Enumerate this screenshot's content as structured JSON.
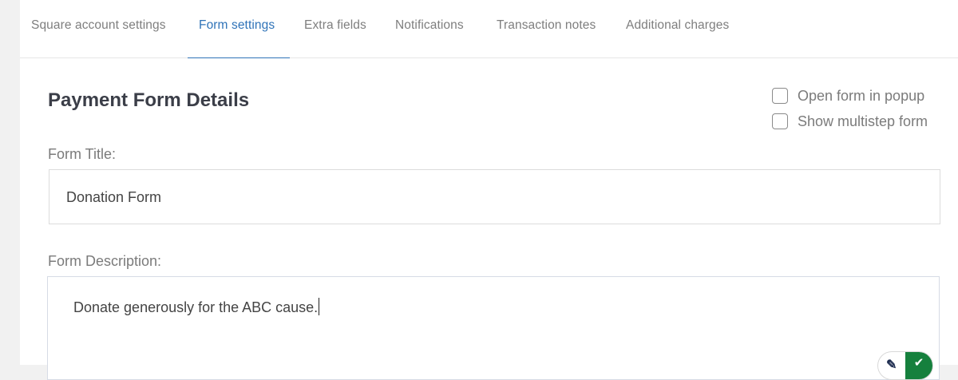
{
  "tabs": [
    {
      "label": "Square account settings",
      "active": false
    },
    {
      "label": "Form settings",
      "active": true
    },
    {
      "label": "Extra fields",
      "active": false
    },
    {
      "label": "Notifications",
      "active": false
    },
    {
      "label": "Transaction notes",
      "active": false
    },
    {
      "label": "Additional charges",
      "active": false
    }
  ],
  "section": {
    "title": "Payment Form Details"
  },
  "options": {
    "popup_label": "Open form in popup",
    "popup_checked": false,
    "multistep_label": "Show multistep form",
    "multistep_checked": false
  },
  "form_title": {
    "label": "Form Title:",
    "value": "Donation Form"
  },
  "form_description": {
    "label": "Form Description:",
    "value": "Donate generously for the ABC cause."
  },
  "icons": {
    "writing_assistant": "writing-assistant-icon"
  },
  "colors": {
    "accent": "#2f73b8",
    "title": "#3b3e48",
    "muted_text": "#7b7b7b",
    "assistant_green": "#15803d"
  }
}
